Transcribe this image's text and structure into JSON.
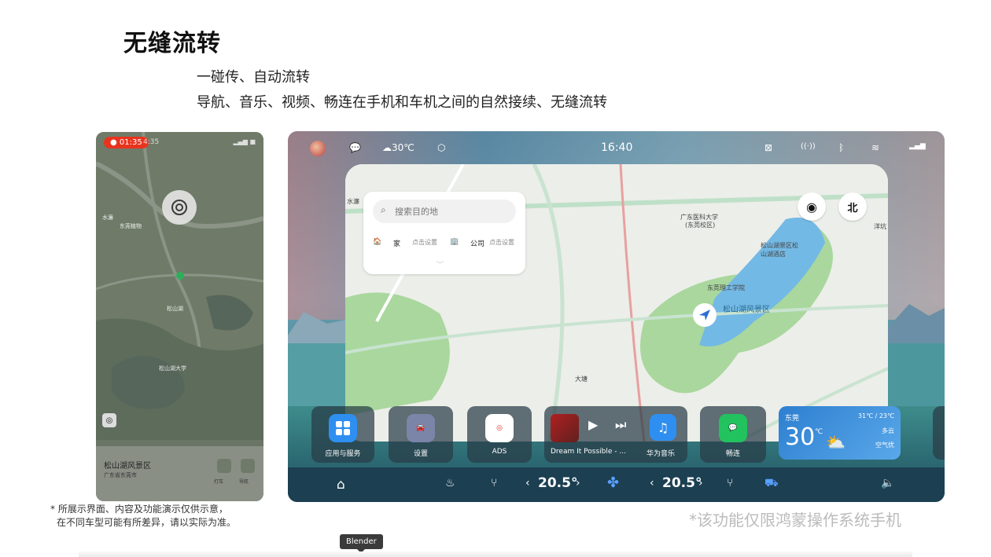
{
  "page": {
    "title": "无缝流转",
    "subtitle1": "一碰传、自动流转",
    "subtitle2": "导航、音乐、视频、畅连在手机和车机之间的自然接续、无缝流转",
    "disclaimer_line1": "* 所展示界面、内容及功能演示仅供示意，",
    "disclaimer_line2": "在不同车型可能有所差异，请以实际为准。",
    "note": "*该功能仅限鸿蒙操作系统手机",
    "tooltip": "Blender"
  },
  "phone": {
    "record_time": "01:35",
    "time": "4:35",
    "place_name": "松山湖风景区",
    "place_address": "广东省东莞市",
    "btn1_label": "打车",
    "btn2_label": "导航",
    "map_labels": [
      "水濂",
      "东莞植物",
      "松山湖",
      "松山湖大学"
    ]
  },
  "car": {
    "status": {
      "weather": "30℃",
      "clock": "16:40"
    },
    "search": {
      "placeholder": "搜索目的地",
      "home_label": "家",
      "home_action": "点击设置",
      "company_label": "公司",
      "company_action": "点击设置"
    },
    "map": {
      "compass": "北",
      "labels": [
        "水濂",
        "广东医科大学",
        "(东莞校区)",
        "松山湖景区松山湖酒店",
        "东莞理工学院",
        "松山湖风景区",
        "大塘",
        "洋坑"
      ]
    },
    "dock": {
      "apps_label": "应用与服务",
      "settings_label": "设置",
      "ads_label": "ADS",
      "music_title": "Dream It Possible - ...",
      "music_app_label": "华为音乐",
      "meetime_label": "畅连"
    },
    "weather_card": {
      "city": "东莞",
      "temp": "30",
      "unit": "℃",
      "range": "31℃ / 23℃",
      "desc": "多云",
      "air": "空气优"
    },
    "bar": {
      "left_temp": "20.5°",
      "right_temp": "20.5°"
    }
  }
}
